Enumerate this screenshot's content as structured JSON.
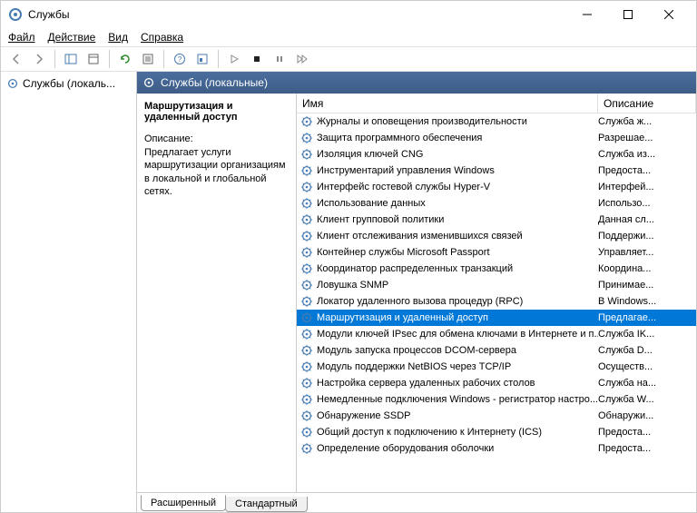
{
  "window": {
    "title": "Службы"
  },
  "menu": {
    "file": "Файл",
    "action": "Действие",
    "view": "Вид",
    "help": "Справка"
  },
  "left": {
    "node": "Службы (локаль..."
  },
  "pane": {
    "header": "Службы (локальные)"
  },
  "detail": {
    "name": "Маршрутизация и удаленный доступ",
    "desc_label": "Описание:",
    "desc_text": "Предлагает услуги маршрутизации организациям в локальной и глобальной сетях."
  },
  "columns": {
    "name": "Имя",
    "desc": "Описание"
  },
  "services": [
    {
      "name": "Журналы и оповещения производительности",
      "desc": "Служба ж..."
    },
    {
      "name": "Защита программного обеспечения",
      "desc": "Разрешае..."
    },
    {
      "name": "Изоляция ключей CNG",
      "desc": "Служба из..."
    },
    {
      "name": "Инструментарий управления Windows",
      "desc": "Предоста..."
    },
    {
      "name": "Интерфейс гостевой службы Hyper-V",
      "desc": "Интерфей..."
    },
    {
      "name": "Использование данных",
      "desc": "Использо..."
    },
    {
      "name": "Клиент групповой политики",
      "desc": "Данная сл..."
    },
    {
      "name": "Клиент отслеживания изменившихся связей",
      "desc": "Поддержи..."
    },
    {
      "name": "Контейнер службы Microsoft Passport",
      "desc": "Управляет..."
    },
    {
      "name": "Координатор распределенных транзакций",
      "desc": "Координа..."
    },
    {
      "name": "Ловушка SNMP",
      "desc": "Принимае..."
    },
    {
      "name": "Локатор удаленного вызова процедур (RPC)",
      "desc": "В Windows..."
    },
    {
      "name": "Маршрутизация и удаленный доступ",
      "desc": "Предлагае...",
      "selected": true
    },
    {
      "name": "Модули ключей IPsec для обмена ключами в Интернете и п...",
      "desc": "Служба IK..."
    },
    {
      "name": "Модуль запуска процессов DCOM-сервера",
      "desc": "Служба D..."
    },
    {
      "name": "Модуль поддержки NetBIOS через TCP/IP",
      "desc": "Осуществ..."
    },
    {
      "name": "Настройка сервера удаленных рабочих столов",
      "desc": "Служба на..."
    },
    {
      "name": "Немедленные подключения Windows - регистратор настро...",
      "desc": "Служба W..."
    },
    {
      "name": "Обнаружение SSDP",
      "desc": "Обнаружи..."
    },
    {
      "name": "Общий доступ к подключению к Интернету (ICS)",
      "desc": "Предоста..."
    },
    {
      "name": "Определение оборудования оболочки",
      "desc": "Предоста..."
    }
  ],
  "tabs": {
    "extended": "Расширенный",
    "standard": "Стандартный"
  }
}
